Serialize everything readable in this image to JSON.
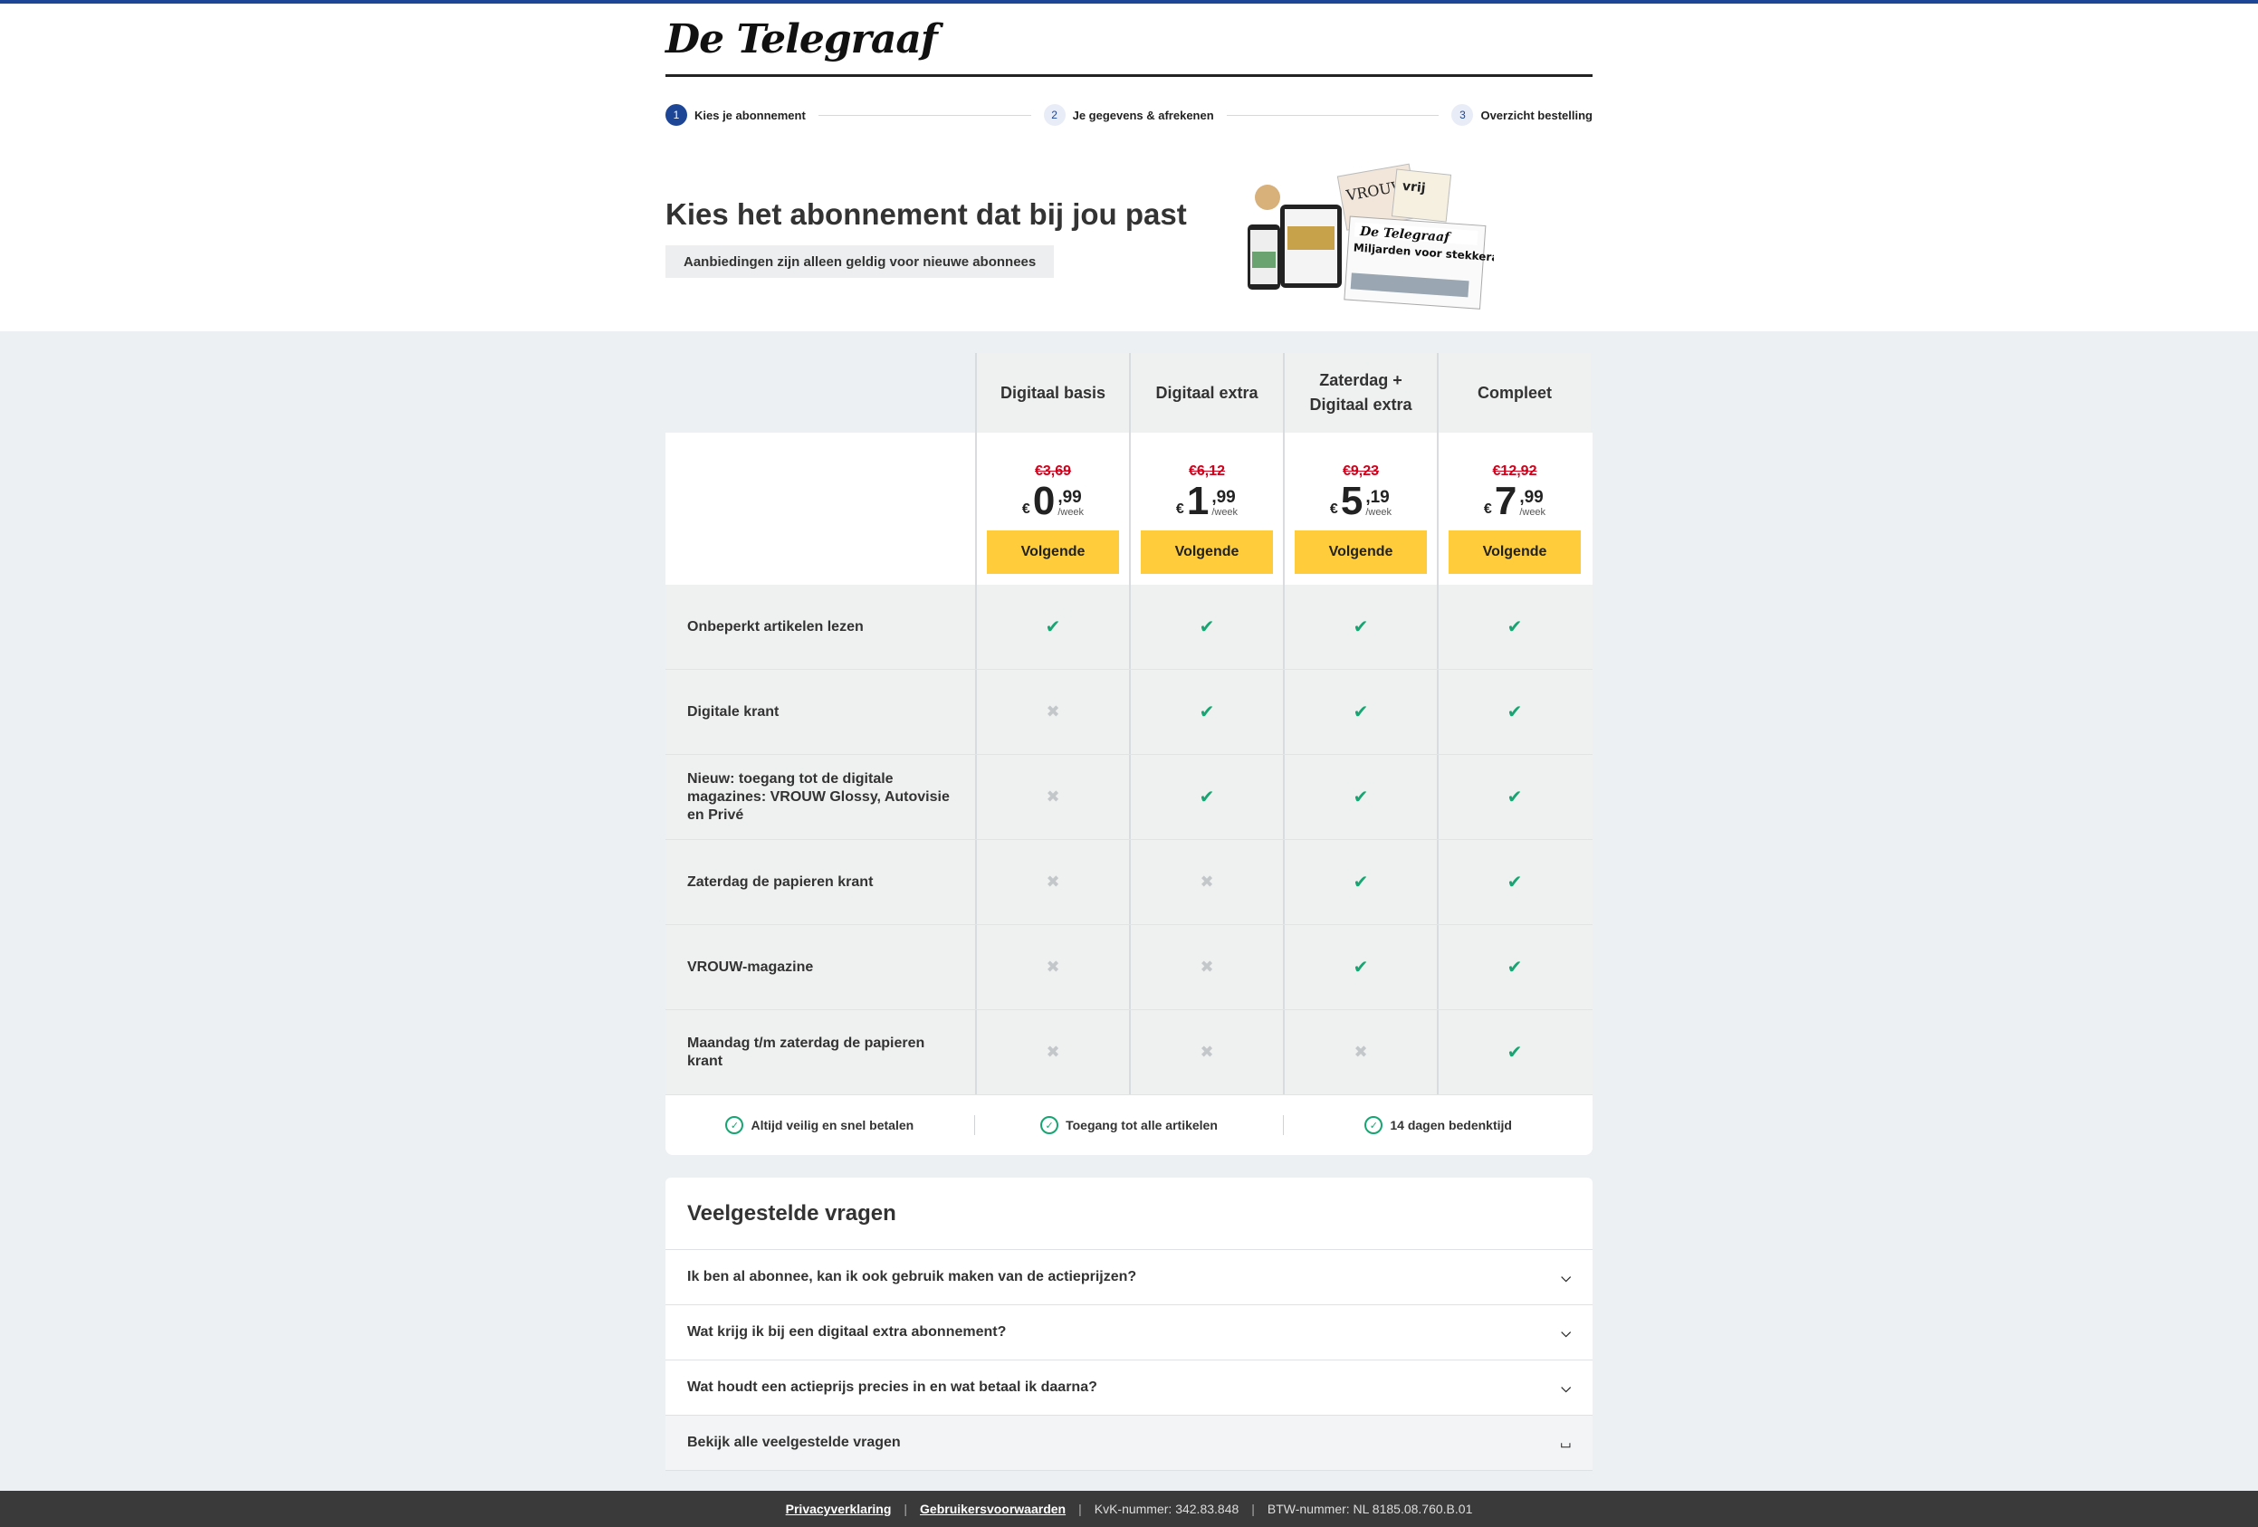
{
  "brand": {
    "logo_text": "De Telegraaf"
  },
  "steps": [
    {
      "num": "1",
      "label": "Kies je abonnement"
    },
    {
      "num": "2",
      "label": "Je gegevens & afrekenen"
    },
    {
      "num": "3",
      "label": "Overzicht bestelling"
    }
  ],
  "hero": {
    "title": "Kies het abonnement dat bij jou past",
    "note": "Aanbiedingen zijn alleen geldig voor nieuwe abonnees",
    "image_newspaper_headline": "Miljarden voor stekkerauto's",
    "image_magazine_titles": [
      "VROUW",
      "vrij"
    ]
  },
  "plans": [
    {
      "name": "Digitaal basis",
      "old_price": "€3,69",
      "currency": "€",
      "euros": "0",
      "cents": ",99",
      "per": "/week",
      "cta": "Volgende"
    },
    {
      "name": "Digitaal extra",
      "old_price": "€6,12",
      "currency": "€",
      "euros": "1",
      "cents": ",99",
      "per": "/week",
      "cta": "Volgende"
    },
    {
      "name": "Zaterdag + Digitaal extra",
      "old_price": "€9,23",
      "currency": "€",
      "euros": "5",
      "cents": ",19",
      "per": "/week",
      "cta": "Volgende"
    },
    {
      "name": "Compleet",
      "old_price": "€12,92",
      "currency": "€",
      "euros": "7",
      "cents": ",99",
      "per": "/week",
      "cta": "Volgende"
    }
  ],
  "features": [
    {
      "label": "Onbeperkt artikelen lezen",
      "included": [
        true,
        true,
        true,
        true
      ]
    },
    {
      "label": "Digitale krant",
      "included": [
        false,
        true,
        true,
        true
      ]
    },
    {
      "label": "Nieuw: toegang tot de digitale magazines: VROUW Glossy, Autovisie en Privé",
      "included": [
        false,
        true,
        true,
        true
      ]
    },
    {
      "label": "Zaterdag de papieren krant",
      "included": [
        false,
        false,
        true,
        true
      ]
    },
    {
      "label": "VROUW-magazine",
      "included": [
        false,
        false,
        true,
        true
      ]
    },
    {
      "label": "Maandag t/m zaterdag de papieren krant",
      "included": [
        false,
        false,
        false,
        true
      ]
    }
  ],
  "benefits": [
    "Altijd veilig en snel betalen",
    "Toegang tot alle artikelen",
    "14 dagen bedenktijd"
  ],
  "faq": {
    "title": "Veelgestelde vragen",
    "items": [
      "Ik ben al abonnee, kan ik ook gebruik maken van de actieprijzen?",
      "Wat krijg ik bij een digitaal extra abonnement?",
      "Wat houdt een actieprijs precies in en wat betaal ik daarna?"
    ],
    "all_label": "Bekijk alle veelgestelde vragen"
  },
  "footer": {
    "privacy": "Privacyverklaring",
    "terms": "Gebruikersvoorwaarden",
    "kvk": "KvK-nummer: 342.83.848",
    "btw": "BTW-nummer: NL 8185.08.760.B.01"
  },
  "colors": {
    "brand_blue": "#1e4696",
    "cta_yellow": "#ffcd3c",
    "check_green": "#17a673",
    "old_price_red": "#d0021b"
  }
}
